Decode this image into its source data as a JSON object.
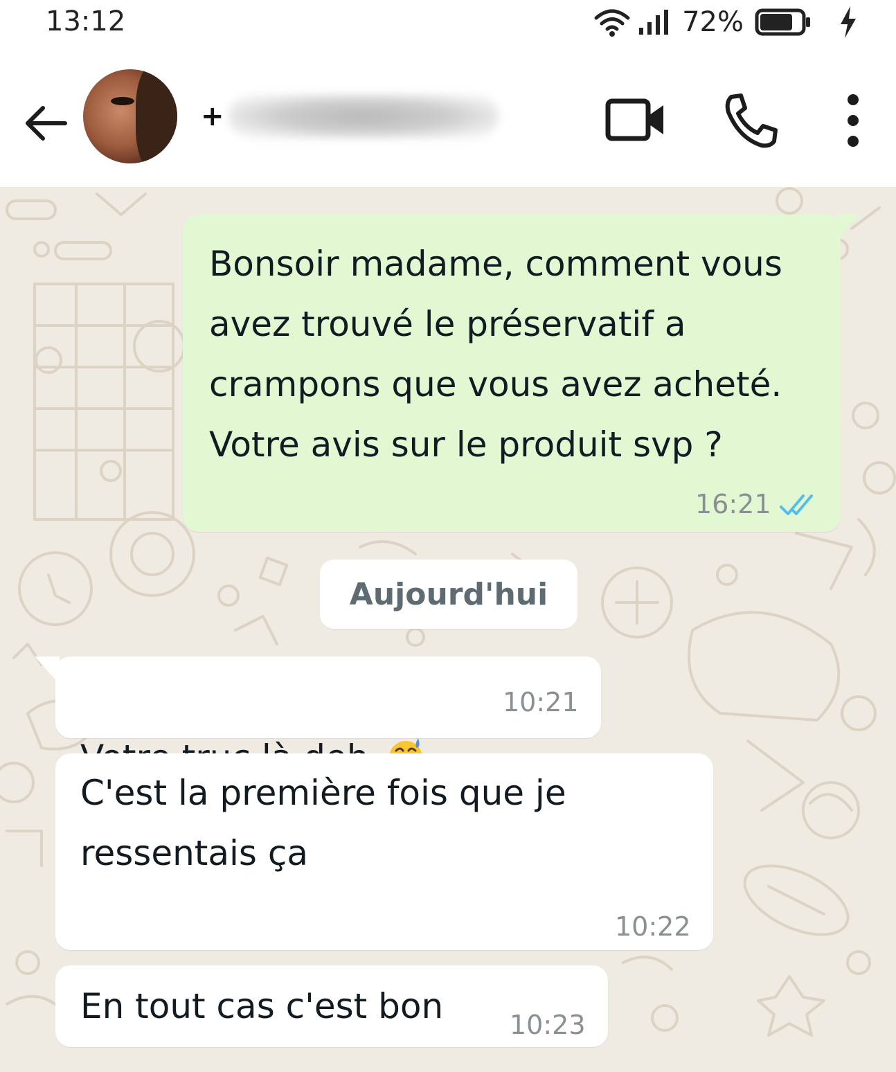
{
  "status_bar": {
    "time": "13:12",
    "battery_percent": "72%"
  },
  "header": {
    "contact_prefix": "+",
    "icons": [
      "back-arrow-icon",
      "video-call-icon",
      "phone-call-icon",
      "more-vert-icon"
    ]
  },
  "chat": {
    "date_separator": "Aujourd'hui",
    "messages": [
      {
        "direction": "outgoing",
        "text": "Bonsoir madame, comment vous\navez trouvé le préservatif a\ncrampons que vous avez acheté.\nVotre avis sur le produit svp ?",
        "time": "16:21",
        "status_icon": "double-check-read-icon"
      },
      {
        "direction": "incoming",
        "text": "Votre truc là deh",
        "emoji": "grinning-face-with-sweat-emoji",
        "time": "10:21"
      },
      {
        "direction": "incoming",
        "text": "C'est la première fois que je\nressentais ça",
        "time": "10:22"
      },
      {
        "direction": "incoming",
        "text": "En tout cas c'est bon",
        "time": "10:23"
      }
    ]
  },
  "colors": {
    "chat_background": "#efeae2",
    "outgoing_bubble": "#e2f8d3",
    "incoming_bubble": "#ffffff",
    "read_tick": "#53bdeb"
  }
}
